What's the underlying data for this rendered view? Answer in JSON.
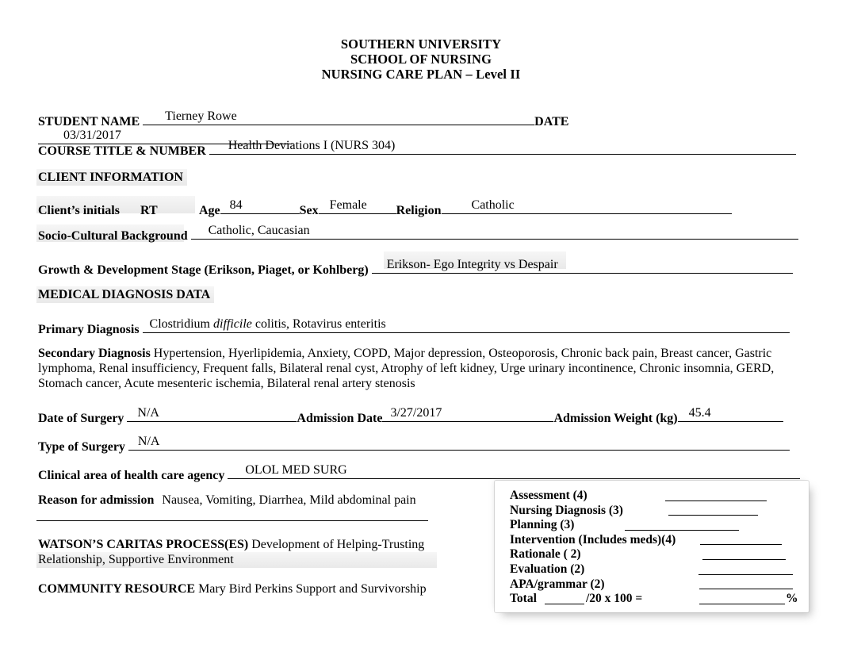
{
  "header": {
    "line1": "SOUTHERN UNIVERSITY",
    "line2": "SCHOOL OF NURSING",
    "line3": "NURSING CARE PLAN – Level II"
  },
  "student": {
    "name_label": "STUDENT NAME",
    "name_value": "Tierney Rowe",
    "date_label": "DATE",
    "date_value": "03/31/2017"
  },
  "course": {
    "label": "COURSE TITLE & NUMBER",
    "value": "Health Deviations I (NURS 304)"
  },
  "client_information": {
    "section_label": "CLIENT INFORMATION",
    "initials_label": "Client’s initials",
    "initials_value": "RT",
    "age_label": "Age",
    "age_value": "84",
    "sex_label": "Sex",
    "sex_value": "Female",
    "religion_label": "Religion",
    "religion_value": "Catholic",
    "socio_label": "Socio-Cultural Background",
    "socio_value": "Catholic, Caucasian",
    "growth_label": "Growth & Development Stage (Erikson, Piaget, or Kohlberg)",
    "growth_value": "Erikson- Ego Integrity vs Despair"
  },
  "medical_diagnosis": {
    "section_label": "MEDICAL DIAGNOSIS DATA",
    "primary_label": "Primary Diagnosis",
    "primary_value_pre": "Clostridium ",
    "primary_value_italic": "difficile",
    "primary_value_post": " colitis, Rotavirus enteritis",
    "secondary_label": "Secondary Diagnosis",
    "secondary_value": "Hypertension, Hyerlipidemia, Anxiety, COPD, Major depression, Osteoporosis, Chronic back pain, Breast cancer, Gastric lymphoma, Renal insufficiency, Frequent falls, Bilateral renal cyst, Atrophy of left kidney, Urge urinary incontinence, Chronic insomnia, GERD, Stomach cancer, Acute mesenteric ischemia, Bilateral renal artery stenosis",
    "date_of_surgery_label": "Date of Surgery",
    "date_of_surgery_value": "N/A",
    "admission_date_label": "Admission Date",
    "admission_date_value": "3/27/2017",
    "admission_weight_label": "Admission Weight (kg)",
    "admission_weight_value": "45.4",
    "type_of_surgery_label": "Type of Surgery",
    "type_of_surgery_value": "N/A",
    "clinical_area_label": "Clinical area of health care agency",
    "clinical_area_value": "OLOL MED SURG",
    "reason_label": "Reason for admission",
    "reason_value": "Nausea, Vomiting, Diarrhea, Mild abdominal pain"
  },
  "watson": {
    "label": "WATSON’S CARITAS PROCESS(ES)",
    "value": "Development of Helping-Trusting Relationship, Supportive Environment"
  },
  "community_resource": {
    "label": "COMMUNITY RESOURCE",
    "value": "Mary Bird Perkins Support and Survivorship"
  },
  "rubric": {
    "items": [
      {
        "label": "Assessment  (4)"
      },
      {
        "label": "Nursing Diagnosis (3)"
      },
      {
        "label": "Planning (3)"
      },
      {
        "label": "Intervention (Includes meds)(4)"
      },
      {
        "label": "Rationale  ( 2)"
      },
      {
        "label": "Evaluation (2)"
      },
      {
        "label": "APA/grammar (2)"
      }
    ],
    "total_label": "Total",
    "total_middle": "/20 x 100 =",
    "total_suffix": "%"
  }
}
